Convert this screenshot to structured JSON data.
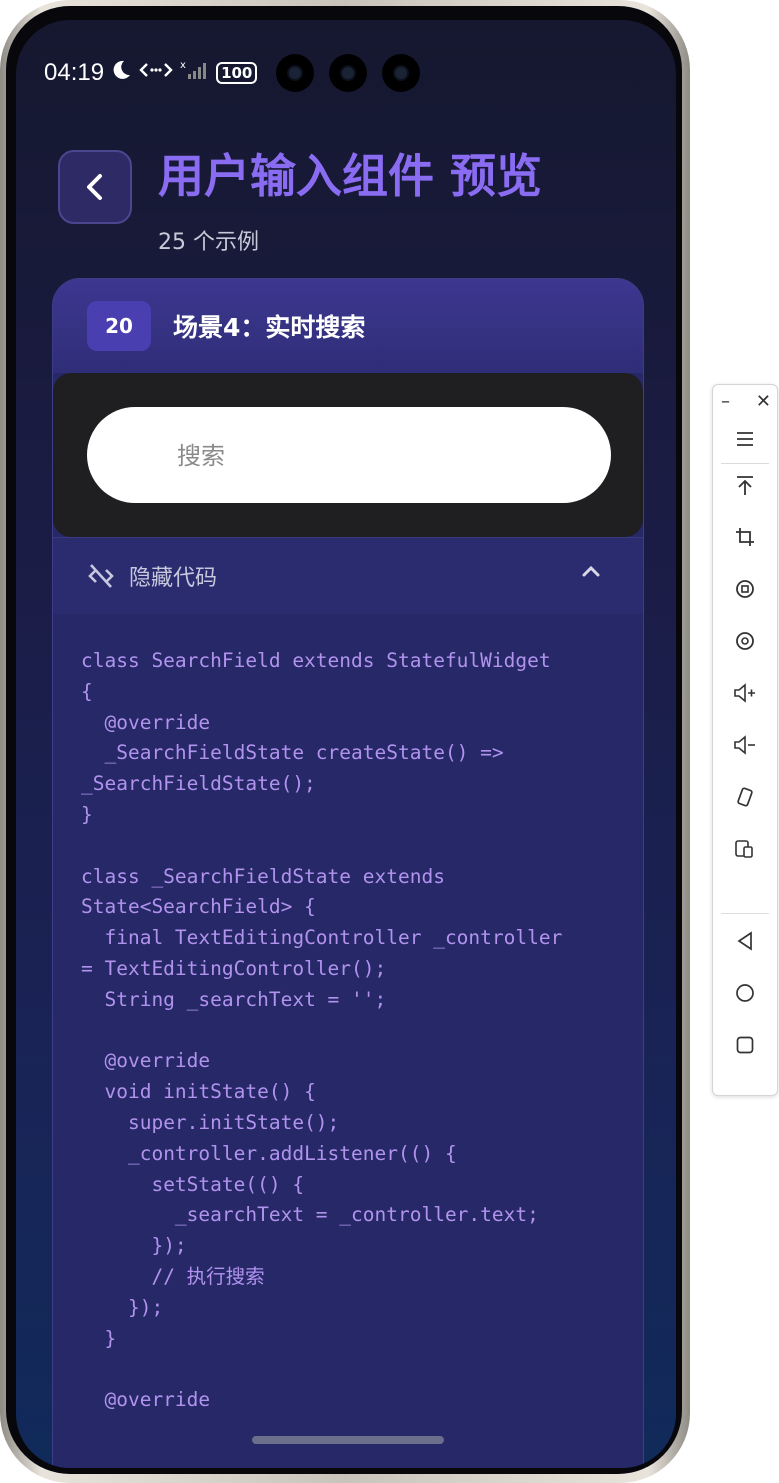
{
  "status": {
    "time": "04:19",
    "battery": "100"
  },
  "header": {
    "title": "用户输入组件 预览",
    "subtitle": "25 个示例"
  },
  "card": {
    "badge": "20",
    "title": "场景4：实时搜索"
  },
  "search": {
    "placeholder": "搜索"
  },
  "code_toggle": {
    "label": "隐藏代码"
  },
  "code": "class SearchField extends StatefulWidget\n{\n  @override\n  _SearchFieldState createState() =>\n_SearchFieldState();\n}\n\nclass _SearchFieldState extends\nState<SearchField> {\n  final TextEditingController _controller\n= TextEditingController();\n  String _searchText = '';\n\n  @override\n  void initState() {\n    super.initState();\n    _controller.addListener(() {\n      setState(() {\n        _searchText = _controller.text;\n      });\n      // 执行搜索\n    });\n  }\n\n  @override",
  "colors": {
    "accent": "#8a6cf3",
    "code": "#b193ee",
    "badge": "#4a3fb0"
  },
  "side_panel": {
    "icons": [
      "minimize-icon",
      "close-icon",
      "menu-icon",
      "pin-top-icon",
      "crop-icon",
      "screen-record-icon",
      "screenshot-icon",
      "volume-up-icon",
      "volume-down-icon",
      "rotate-icon",
      "mirror-device-icon",
      "nav-back-icon",
      "nav-home-icon",
      "nav-recents-icon"
    ]
  }
}
